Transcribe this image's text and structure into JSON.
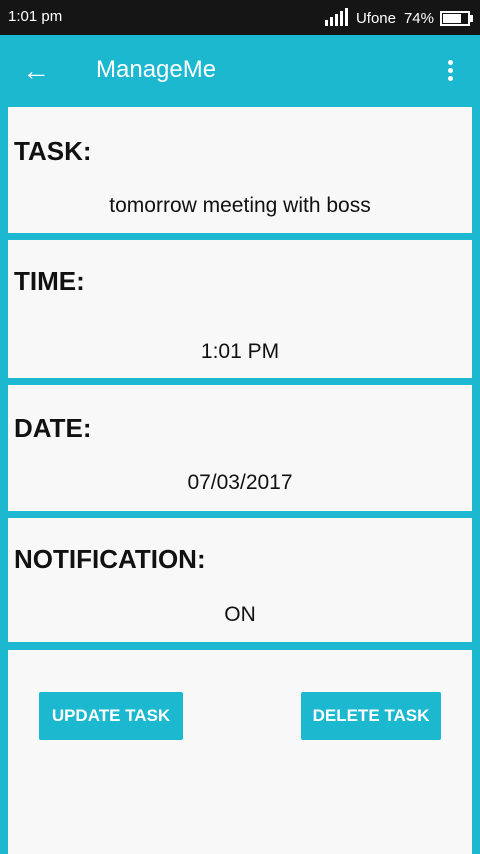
{
  "status_bar": {
    "time": "1:01 pm",
    "carrier": "Ufone",
    "battery": "74%"
  },
  "app_bar": {
    "title": "ManageMe"
  },
  "task": {
    "label": "TASK:",
    "value": "tomorrow meeting with boss"
  },
  "time": {
    "label": "TIME:",
    "value": "1:01 PM"
  },
  "date": {
    "label": "DATE:",
    "value": "07/03/2017"
  },
  "notification": {
    "label": "NOTIFICATION:",
    "value": "ON"
  },
  "actions": {
    "update_label": "UPDATE TASK",
    "delete_label": "DELETE TASK"
  },
  "colors": {
    "accent": "#1cb8d0",
    "card_bg": "#f8f8f8",
    "status_bar": "#151515"
  },
  "icons": {
    "back": "back-arrow-icon",
    "menu": "overflow-menu-icon"
  }
}
